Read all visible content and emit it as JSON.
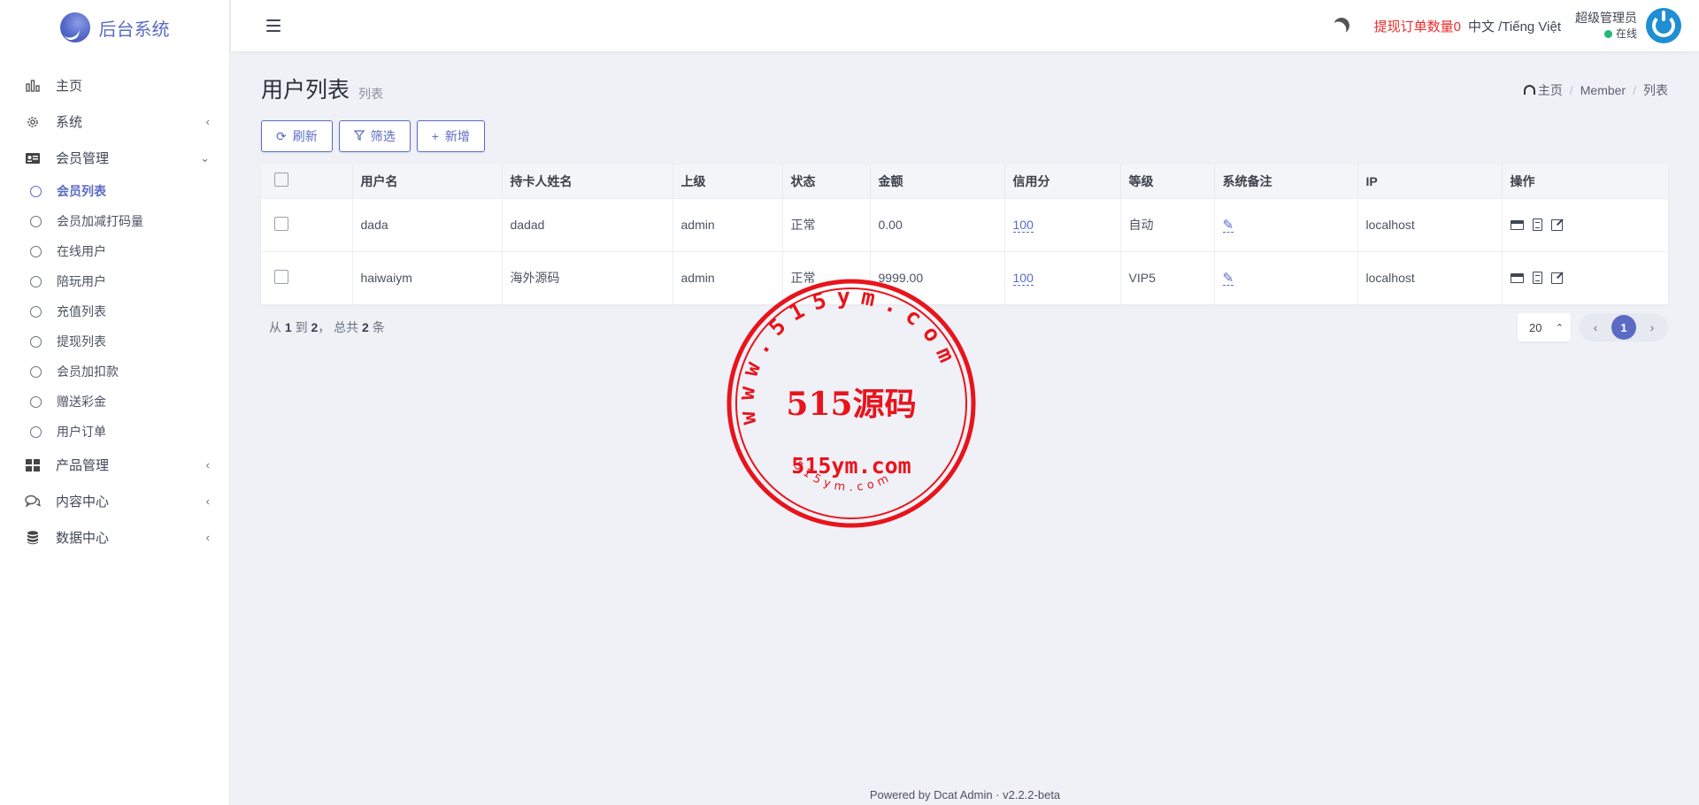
{
  "brand": {
    "name": "后台系统"
  },
  "sidebar": {
    "items": [
      {
        "label": "主页",
        "icon": "bar-chart-icon",
        "has_arrow": false
      },
      {
        "label": "系统",
        "icon": "gear-icon",
        "has_arrow": true,
        "arrow": "‹"
      },
      {
        "label": "会员管理",
        "icon": "id-card-icon",
        "has_arrow": true,
        "arrow": "⌄"
      }
    ],
    "member_sub": [
      {
        "label": "会员列表",
        "active": true
      },
      {
        "label": "会员加减打码量",
        "active": false
      },
      {
        "label": "在线用户",
        "active": false
      },
      {
        "label": "陪玩用户",
        "active": false
      },
      {
        "label": "充值列表",
        "active": false
      },
      {
        "label": "提现列表",
        "active": false
      },
      {
        "label": "会员加扣款",
        "active": false
      },
      {
        "label": "赠送彩金",
        "active": false
      },
      {
        "label": "用户订单",
        "active": false
      }
    ],
    "items_after": [
      {
        "label": "产品管理",
        "icon": "grid-icon",
        "arrow": "‹"
      },
      {
        "label": "内容中心",
        "icon": "chat-icon",
        "arrow": "‹"
      },
      {
        "label": "数据中心",
        "icon": "database-icon",
        "arrow": "‹"
      }
    ]
  },
  "header": {
    "withdraw_label": "提现订单数量0",
    "lang_label": "中文 /Tiếng Việt",
    "user_name": "超级管理员",
    "user_status": "在线"
  },
  "page": {
    "title": "用户列表",
    "subtitle": "列表",
    "breadcrumb": [
      "主页",
      "Member",
      "列表"
    ]
  },
  "toolbar": {
    "refresh_label": "刷新",
    "filter_label": "筛选",
    "new_label": "新增"
  },
  "table": {
    "columns": [
      "用户名",
      "持卡人姓名",
      "上级",
      "状态",
      "金额",
      "信用分",
      "等级",
      "系统备注",
      "IP",
      "操作"
    ],
    "rows": [
      {
        "username": "dada",
        "cardholder": "dadad",
        "parent": "admin",
        "status": "正常",
        "amount": "0.00",
        "credit": "100",
        "level": "自动",
        "ip": "localhost"
      },
      {
        "username": "haiwaiym",
        "cardholder": "海外源码",
        "parent": "admin",
        "status": "正常",
        "amount": "9999.00",
        "credit": "100",
        "level": "VIP5",
        "ip": "localhost"
      }
    ]
  },
  "pagination": {
    "summary_from": "从",
    "from": "1",
    "summary_to": "到",
    "to": "2",
    "summary_total": "， 总共",
    "total": "2",
    "summary_unit": "条",
    "per_page": "20",
    "current_page": "1"
  },
  "footer": {
    "text": "Powered by Dcat Admin  ·  v2.2.2-beta"
  },
  "watermark": {
    "ring_text": "www.515ym.com",
    "center_text": "515源码",
    "domain_text": "515ym.com",
    "bottom_text": "515ym.com",
    "color": "#e8141c"
  },
  "colors": {
    "accent": "#5b6bc4",
    "alert": "#ef2b2b",
    "online": "#21b978"
  }
}
